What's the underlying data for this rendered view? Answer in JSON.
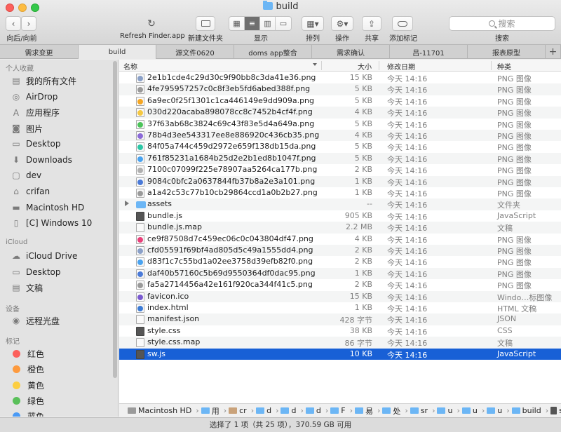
{
  "window": {
    "title": "build"
  },
  "toolbar": {
    "nav_label": "向后/向前",
    "refresh_label": "Refresh Finder.app",
    "new_folder_label": "新建文件夹",
    "view_label": "显示",
    "arrange_label": "排列",
    "action_label": "操作",
    "share_label": "共享",
    "tag_label": "添加标记",
    "search_placeholder": "搜索",
    "search_label": "搜索"
  },
  "tabs": [
    {
      "label": "需求变更"
    },
    {
      "label": "build",
      "active": true
    },
    {
      "label": "源文件0620"
    },
    {
      "label": "doms app整合"
    },
    {
      "label": "需求确认"
    },
    {
      "label": "吕-11701"
    },
    {
      "label": "报表原型"
    }
  ],
  "sidebar": {
    "favorites_header": "个人收藏",
    "favorites": [
      {
        "label": "我的所有文件",
        "icon": "all-files-icon"
      },
      {
        "label": "AirDrop",
        "icon": "airdrop-icon"
      },
      {
        "label": "应用程序",
        "icon": "applications-icon"
      },
      {
        "label": "图片",
        "icon": "pictures-icon"
      },
      {
        "label": "Desktop",
        "icon": "desktop-icon"
      },
      {
        "label": "Downloads",
        "icon": "downloads-icon"
      },
      {
        "label": "dev",
        "icon": "folder-icon"
      },
      {
        "label": "crifan",
        "icon": "home-icon"
      },
      {
        "label": "Macintosh HD",
        "icon": "disk-icon"
      },
      {
        "label": "[C] Windows 10",
        "icon": "document-icon"
      }
    ],
    "icloud_header": "iCloud",
    "icloud": [
      {
        "label": "iCloud Drive",
        "icon": "cloud-icon"
      },
      {
        "label": "Desktop",
        "icon": "desktop-icon"
      },
      {
        "label": "文稿",
        "icon": "documents-icon"
      }
    ],
    "devices_header": "设备",
    "devices": [
      {
        "label": "远程光盘",
        "icon": "disc-icon"
      }
    ],
    "tags_header": "标记",
    "tags": [
      {
        "label": "红色",
        "color": "#fc605c"
      },
      {
        "label": "橙色",
        "color": "#fd9a3e"
      },
      {
        "label": "黄色",
        "color": "#fcce42"
      },
      {
        "label": "绿色",
        "color": "#5ac05a"
      },
      {
        "label": "蓝色",
        "color": "#4a9af5"
      }
    ]
  },
  "columns": {
    "name": "名称",
    "size": "大小",
    "date": "修改日期",
    "kind": "种类"
  },
  "files": [
    {
      "name": "2e1b1cde4c29d30c9f90bb8c3da41e36.png",
      "size": "15 KB",
      "date": "今天 14:16",
      "kind": "PNG 图像",
      "icon": "#8aa0c8"
    },
    {
      "name": "4fe795957257c0c8f3eb5fd6abed388f.png",
      "size": "5 KB",
      "date": "今天 14:16",
      "kind": "PNG 图像",
      "icon": "#9a9a9a"
    },
    {
      "name": "6a9ec0f25f1301c1ca446149e9dd909a.png",
      "size": "5 KB",
      "date": "今天 14:16",
      "kind": "PNG 图像",
      "icon": "#f5a623"
    },
    {
      "name": "030d220acaba898078cc8c7452b4cf4f.png",
      "size": "4 KB",
      "date": "今天 14:16",
      "kind": "PNG 图像",
      "icon": "#f5c842"
    },
    {
      "name": "37f63ab68c3824c69c43f83e5d4a649a.png",
      "size": "5 KB",
      "date": "今天 14:16",
      "kind": "PNG 图像",
      "icon": "#4cc35a"
    },
    {
      "name": "78b4d3ee543317ee8e886920c436cb35.png",
      "size": "4 KB",
      "date": "今天 14:16",
      "kind": "PNG 图像",
      "icon": "#8b6ad8"
    },
    {
      "name": "84f05a744c459d2972e659f138db15da.png",
      "size": "5 KB",
      "date": "今天 14:16",
      "kind": "PNG 图像",
      "icon": "#2cc7a6"
    },
    {
      "name": "761f85231a1684b25d2e2b1ed8b1047f.png",
      "size": "5 KB",
      "date": "今天 14:16",
      "kind": "PNG 图像",
      "icon": "#4aa3f0"
    },
    {
      "name": "7100c07099f225e78907aa5264ca177b.png",
      "size": "2 KB",
      "date": "今天 14:16",
      "kind": "PNG 图像",
      "icon": "#b0b0b0"
    },
    {
      "name": "9084c0bfc2a0637844fb37b8a2e3a101.png",
      "size": "1 KB",
      "date": "今天 14:16",
      "kind": "PNG 图像",
      "icon": "#4a7ad8"
    },
    {
      "name": "a1a42c53c77b10cb29864ccd1a0b2b27.png",
      "size": "1 KB",
      "date": "今天 14:16",
      "kind": "PNG 图像",
      "icon": "#9a9a9a"
    },
    {
      "name": "assets",
      "size": "--",
      "date": "今天 14:16",
      "kind": "文件夹",
      "folder": true
    },
    {
      "name": "bundle.js",
      "size": "905 KB",
      "date": "今天 14:16",
      "kind": "JavaScript",
      "dark": true
    },
    {
      "name": "bundle.js.map",
      "size": "2.2 MB",
      "date": "今天 14:16",
      "kind": "文稿"
    },
    {
      "name": "ce9f87508d7c459ec06c0c043804df47.png",
      "size": "4 KB",
      "date": "今天 14:16",
      "kind": "PNG 图像",
      "icon": "#e9407a"
    },
    {
      "name": "cfd05591f69bf4ad805d5c49a1555dd4.png",
      "size": "2 KB",
      "date": "今天 14:16",
      "kind": "PNG 图像",
      "icon": "#8aa0c8"
    },
    {
      "name": "d83f1c7c55bd1a02ee3758d39efb82f0.png",
      "size": "2 KB",
      "date": "今天 14:16",
      "kind": "PNG 图像",
      "icon": "#4aa3f0"
    },
    {
      "name": "daf40b57160c5b69d9550364df0dac95.png",
      "size": "1 KB",
      "date": "今天 14:16",
      "kind": "PNG 图像",
      "icon": "#4a7ad8"
    },
    {
      "name": "fa5a2714456a42e161f920ca344f41c5.png",
      "size": "2 KB",
      "date": "今天 14:16",
      "kind": "PNG 图像",
      "icon": "#9a9a9a"
    },
    {
      "name": "favicon.ico",
      "size": "15 KB",
      "date": "今天 14:16",
      "kind": "Windo…标图像",
      "icon": "#7a5ad0"
    },
    {
      "name": "index.html",
      "size": "1 KB",
      "date": "今天 14:16",
      "kind": "HTML 文稿",
      "icon": "#3b7bd6"
    },
    {
      "name": "manifest.json",
      "size": "428 字节",
      "date": "今天 14:16",
      "kind": "JSON"
    },
    {
      "name": "style.css",
      "size": "38 KB",
      "date": "今天 14:16",
      "kind": "CSS",
      "dark": true
    },
    {
      "name": "style.css.map",
      "size": "86 字节",
      "date": "今天 14:16",
      "kind": "文稿"
    },
    {
      "name": "sw.js",
      "size": "10 KB",
      "date": "今天 14:16",
      "kind": "JavaScript",
      "dark": true,
      "selected": true
    }
  ],
  "pathbar": [
    {
      "label": "Macintosh HD",
      "type": "disk"
    },
    {
      "label": "用",
      "type": "folder"
    },
    {
      "label": "cr",
      "type": "home"
    },
    {
      "label": "d",
      "type": "folder"
    },
    {
      "label": "d",
      "type": "folder"
    },
    {
      "label": "d",
      "type": "folder"
    },
    {
      "label": "F",
      "type": "folder"
    },
    {
      "label": "易",
      "type": "folder"
    },
    {
      "label": "处",
      "type": "folder"
    },
    {
      "label": "sr",
      "type": "folder"
    },
    {
      "label": "u",
      "type": "folder"
    },
    {
      "label": "u",
      "type": "folder"
    },
    {
      "label": "u",
      "type": "folder"
    },
    {
      "label": "build",
      "type": "folder"
    },
    {
      "label": "sw.js",
      "type": "file"
    }
  ],
  "status": "选择了 1 项（共 25 项），370.59 GB 可用"
}
